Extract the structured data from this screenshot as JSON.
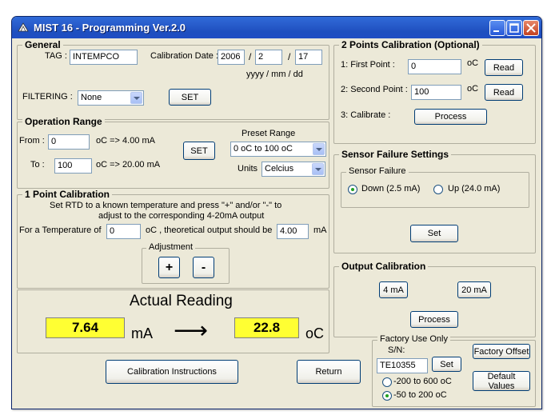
{
  "window": {
    "title": "MIST 16 - Programming Ver.2.0"
  },
  "general": {
    "legend": "General",
    "tag_label": "TAG :",
    "tag_value": "INTEMPCO",
    "cal_date_label": "Calibration Date :",
    "date_year": "2006",
    "date_month": "2",
    "date_day": "17",
    "slash": "/",
    "date_format": "yyyy / mm / dd",
    "filtering_label": "FILTERING :",
    "filtering_value": "None",
    "set_label": "SET"
  },
  "operation_range": {
    "legend": "Operation Range",
    "from_label": "From :",
    "from_value": "0",
    "from_unit": "oC  => 4.00 mA",
    "to_label": "To :",
    "to_value": "100",
    "to_unit": "oC  => 20.00 mA",
    "set_label": "SET",
    "preset_label": "Preset Range",
    "preset_value": "0 oC to 100 oC",
    "units_label": "Units",
    "units_value": "Celcius"
  },
  "one_point": {
    "legend": "1 Point Calibration",
    "instruction_1": "Set RTD to a known temperature and press \"+\" and/or \"-\" to",
    "instruction_2": "adjust to the corresponding 4-20mA output",
    "for_temp_label": "For a Temperature of",
    "temp_value": "0",
    "theoretical_label": "oC  , theoretical output should be",
    "output_value": "4.00",
    "ma": "mA",
    "adjustment_legend": "Adjustment",
    "plus": "+",
    "minus": "-"
  },
  "actual_reading": {
    "title": "Actual Reading",
    "ma_value": "7.64",
    "ma_unit": "mA",
    "arrow": "⟶",
    "oc_value": "22.8",
    "oc_unit": "oC"
  },
  "two_point": {
    "legend": "2 Points Calibration (Optional)",
    "first_label": "1: First Point :",
    "first_value": "0",
    "second_label": "2: Second Point :",
    "second_value": "100",
    "unit": "oC",
    "read_label": "Read",
    "calibrate_label": "3: Calibrate :",
    "process_label": "Process"
  },
  "sensor_failure": {
    "legend": "Sensor Failure Settings",
    "inner_legend": "Sensor Failure",
    "down_label": "Down (2.5 mA)",
    "up_label": "Up (24.0 mA)",
    "selected": "down",
    "set_label": "Set"
  },
  "output_calibration": {
    "legend": "Output Calibration",
    "btn_4ma": "4 mA",
    "btn_20ma": "20 mA",
    "process_label": "Process"
  },
  "factory": {
    "legend": "Factory Use Only",
    "sn_label": "S/N:",
    "sn_value": "TE10355",
    "set_label": "Set",
    "range_1": "-200 to 600 oC",
    "range_2": "-50 to 200 oC",
    "selected_range": "range_2",
    "offset_label": "Factory Offset",
    "defaults_label": "Default Values"
  },
  "footer": {
    "instructions_label": "Calibration Instructions",
    "return_label": "Return"
  },
  "colors": {
    "titlebar": "#2a5fce",
    "window_bg": "#ece9d8",
    "display_bg": "#ffff33"
  }
}
